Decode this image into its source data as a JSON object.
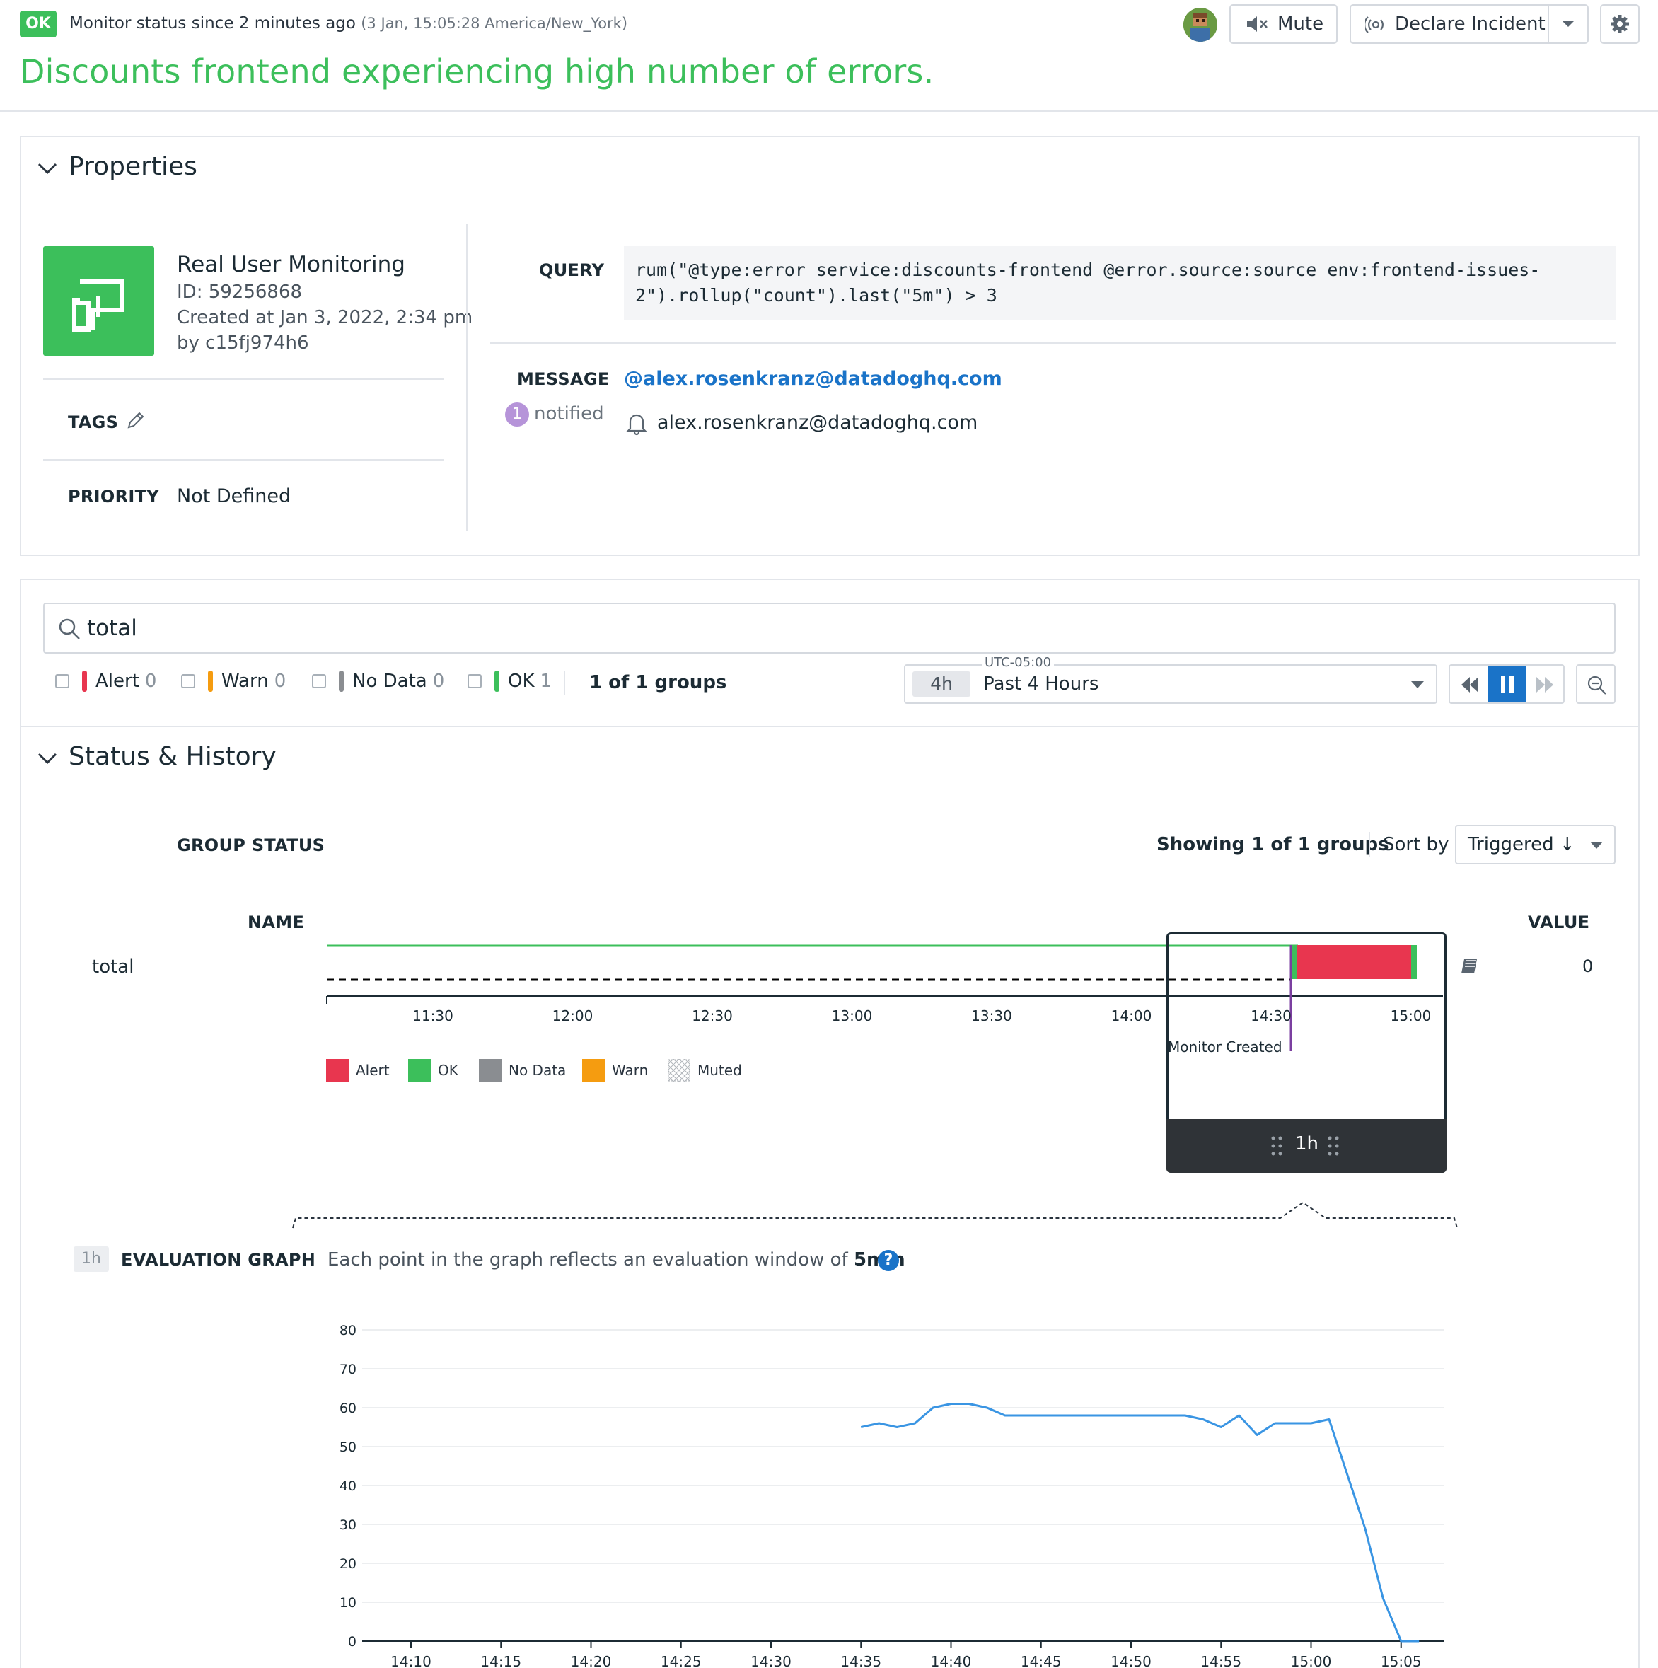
{
  "header": {
    "status_badge": "OK",
    "status_text": "Monitor status since 2 minutes ago",
    "status_time": "(3 Jan, 15:05:28 America/New_York)",
    "title": "Discounts frontend experiencing high number of errors.",
    "mute_label": "Mute",
    "declare_label": "Declare Incident"
  },
  "properties": {
    "section_title": "Properties",
    "monitor_type": "Real User Monitoring",
    "id_text": "ID: 59256868",
    "created_text": "Created at Jan 3, 2022, 2:34 pm",
    "by_text": "by c15fj974h6",
    "tags_label": "TAGS",
    "priority_label": "PRIORITY",
    "priority_value": "Not Defined",
    "query_label": "QUERY",
    "query_line1": "rum(\"@type:error service:discounts-frontend @error.source:source env:frontend-issues-",
    "query_line2": "2\").rollup(\"count\").last(\"5m\") > 3",
    "message_label": "MESSAGE",
    "message_mention": "@alex.rosenkranz@datadoghq.com",
    "notified_count": "1",
    "notified_label": "notified",
    "notified_email": "alex.rosenkranz@datadoghq.com"
  },
  "filters": {
    "search_value": "total",
    "alert_label": "Alert",
    "alert_count": "0",
    "warn_label": "Warn",
    "warn_count": "0",
    "nodata_label": "No Data",
    "nodata_count": "0",
    "ok_label": "OK",
    "ok_count": "1",
    "groups_text": "1 of 1 groups",
    "timezone": "UTC-05:00",
    "time_badge": "4h",
    "time_range": "Past 4 Hours"
  },
  "status_history": {
    "section_title": "Status & History",
    "group_status_label": "GROUP STATUS",
    "showing_text": "Showing 1 of 1 groups",
    "sort_by_label": "Sort by",
    "sort_value": "Triggered ↓",
    "name_header": "NAME",
    "value_header": "VALUE",
    "row_name": "total",
    "row_value": "0",
    "timeline_ticks": [
      "11:30",
      "12:00",
      "12:30",
      "13:00",
      "13:30",
      "14:00",
      "14:30",
      "15:00"
    ],
    "monitor_created": "Monitor Created",
    "window_label": "1h",
    "legend": [
      "Alert",
      "OK",
      "No Data",
      "Warn",
      "Muted"
    ],
    "colors": {
      "alert": "#e8364f",
      "ok": "#3cbf5b",
      "nodata": "#8a8d91",
      "warn": "#f59c10",
      "line": "#3a95e3"
    }
  },
  "evaluation": {
    "badge": "1h",
    "label": "EVALUATION GRAPH",
    "desc_prefix": "Each point in the graph reflects an evaluation window of",
    "desc_bold": "5min"
  },
  "chart_data": {
    "type": "line",
    "ylim": [
      0,
      80
    ],
    "yticks": [
      0,
      10,
      20,
      30,
      40,
      50,
      60,
      70,
      80
    ],
    "xticks": [
      "14:10",
      "14:15",
      "14:20",
      "14:25",
      "14:30",
      "14:35",
      "14:40",
      "14:45",
      "14:50",
      "14:55",
      "15:00",
      "15:05"
    ],
    "series": [
      {
        "x": [
          "14:35",
          "14:36",
          "14:37",
          "14:38",
          "14:39",
          "14:40",
          "14:41",
          "14:42",
          "14:43",
          "14:44",
          "14:45",
          "14:46",
          "14:47",
          "14:48",
          "14:49",
          "14:50",
          "14:51",
          "14:52",
          "14:53",
          "14:54",
          "14:55",
          "14:56",
          "14:57",
          "14:58",
          "14:59",
          "15:00",
          "15:01",
          "15:02",
          "15:03",
          "15:04",
          "15:05",
          "15:06"
        ],
        "values": [
          55,
          56,
          55,
          56,
          60,
          61,
          61,
          60,
          58,
          58,
          58,
          58,
          58,
          58,
          58,
          58,
          58,
          58,
          58,
          57,
          55,
          58,
          53,
          56,
          56,
          56,
          57,
          43,
          29,
          11,
          0,
          0
        ]
      }
    ]
  }
}
